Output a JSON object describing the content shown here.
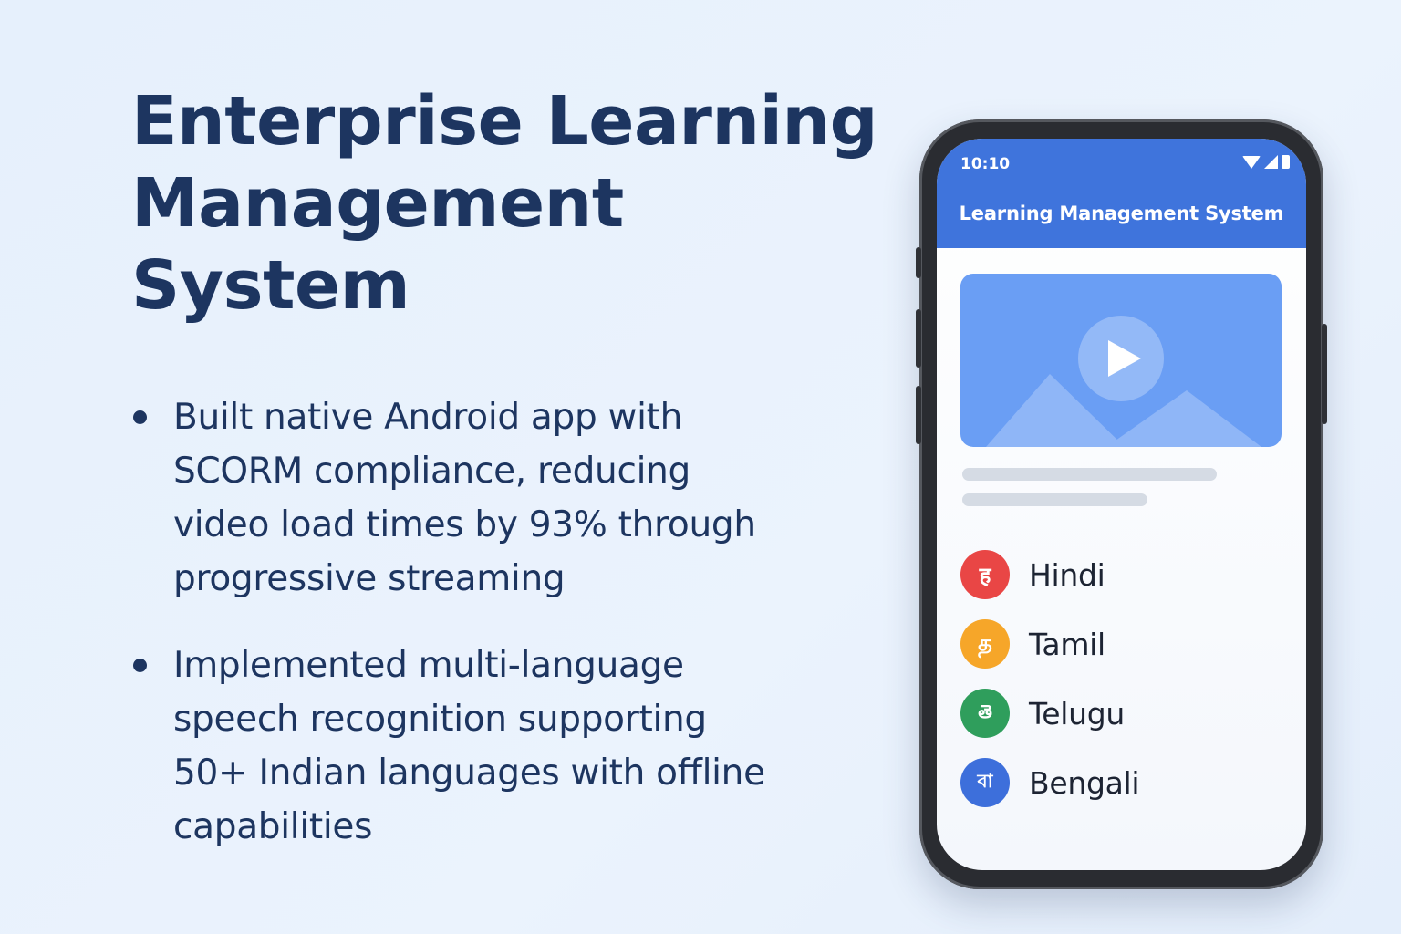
{
  "headline": {
    "line1": "Enterprise Learning",
    "line2": "Management System"
  },
  "bullets": [
    {
      "text": "Built native Android app with\nSCORM compliance, reducing\nvideo load times by 93% through\nprogressive streaming"
    },
    {
      "text": "Implemented multi-language\nspeech recognition supporting\n50+ Indian languages with offline\ncapabilities"
    }
  ],
  "phone": {
    "status_time": "10:10",
    "status_icons": [
      "wifi-icon",
      "signal-icon",
      "battery-icon"
    ],
    "app_title": "Learning Management System",
    "video_icon": "play-icon",
    "languages": [
      {
        "label": "Hindi",
        "glyph": "ह",
        "color": "#e94645"
      },
      {
        "label": "Tamil",
        "glyph": "த",
        "color": "#f6a629"
      },
      {
        "label": "Telugu",
        "glyph": "తె",
        "color": "#2f9e5c"
      },
      {
        "label": "Bengali",
        "glyph": "বা",
        "color": "#3d6fdb"
      }
    ]
  },
  "colors": {
    "headline": "#1d3560",
    "app_bar": "#3f74dc",
    "video_bg": "#6a9ef4",
    "background": "#e8f1fc"
  }
}
